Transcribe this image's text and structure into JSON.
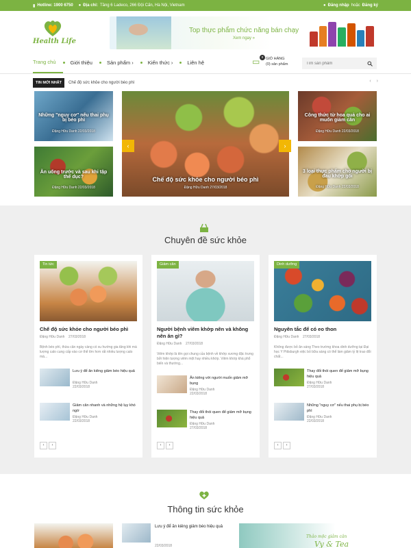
{
  "topbar": {
    "hotline": "Hotline: 1900 6750",
    "address_label": "Địa chỉ:",
    "address": "Tầng 6 Ladeco, 266 Đội Cấn, Hà Nội, Vietnam",
    "login": "Đăng nhập",
    "or": "hoặc",
    "register": "Đăng ký"
  },
  "header": {
    "logo_text": "Health Life",
    "banner_title": "Top thực phẩm chức năng bán chạy",
    "banner_link": "Xem ngay »"
  },
  "nav": {
    "items": [
      {
        "label": "Trang chủ"
      },
      {
        "label": "Giới thiệu"
      },
      {
        "label": "Sản phẩm ›"
      },
      {
        "label": "Kiến thức ›"
      },
      {
        "label": "Liên hệ"
      }
    ],
    "cart_count": "0",
    "cart_title": "GIỎ HÀNG",
    "cart_sub": "(0) sản phẩm",
    "search_placeholder": "Tìm sản phẩm"
  },
  "news": {
    "label": "TIN MỚI NHẤT",
    "text": "Chế độ sức khỏe cho người béo phì"
  },
  "slider": {
    "left_top": {
      "title": "Những \"nguy cơ\" nếu thai phụ bị béo phì",
      "meta": "Đặng Hữu Danh    22/03/2018"
    },
    "left_bottom": {
      "title": "Ăn uống trước và sau khi tập thể dục?",
      "meta": "Đặng Hữu Danh    22/03/2018"
    },
    "center": {
      "title": "Chế độ sức khỏe cho người béo phì",
      "meta": "Đặng Hữu Danh    27/03/2018"
    },
    "right_top": {
      "title": "Công thức từ hoa quả cho ai muốn giảm cân",
      "meta": "Đặng Hữu Danh    22/03/2018"
    },
    "right_bottom": {
      "title": "3 loại thực phẩm cho người bị đau khớp gối",
      "meta": "Đặng Hữu Danh    22/03/2018"
    }
  },
  "section1": {
    "title": "Chuyên đề sức khỏe"
  },
  "cards": [
    {
      "badge": "Tin tức",
      "title": "Chế độ sức khỏe cho người béo phì",
      "author": "Đặng Hữu Danh",
      "date": "27/03/2018",
      "excerpt": "Bệnh béo phì, thừa cân ngày càng có xu hướng gia tăng khi mà lượng calo cung cấp vào cơ thể lớn hơn rất nhiều lượng calo mà...",
      "items": [
        {
          "title": "Lưu ý để ăn kiêng giảm béo hiệu quả",
          "author": "Đặng Hữu Danh",
          "date": "22/03/2018"
        },
        {
          "title": "Giảm cân nhanh và những hệ lụy khó ngờ",
          "author": "Đặng Hữu Danh",
          "date": "22/03/2018"
        }
      ]
    },
    {
      "badge": "Giảm cân",
      "title": "Người bệnh viêm khớp nên và không nên ăn gì?",
      "author": "Đặng Hữu Danh",
      "date": "27/03/2018",
      "excerpt": "Viêm khớp là tên gọi chung của bệnh về khớp xương đặc trưng bởi hiện tượng viêm một hay nhiều khớp. Viêm khớp khá phổ biến và thường...",
      "items": [
        {
          "title": "Ăn kiêng với người muốn giảm mỡ bụng",
          "author": "Đặng Hữu Danh",
          "date": "22/03/2018"
        },
        {
          "title": "Thay đổi thói quen để giảm mỡ bụng hiệu quả",
          "author": "Đặng Hữu Danh",
          "date": "27/03/2018"
        }
      ]
    },
    {
      "badge": "Dinh dưỡng",
      "title": "Nguyên tắc để có eo thon",
      "author": "Đặng Hữu Danh",
      "date": "27/03/2018",
      "excerpt": "Không được bỏ ăn sáng Theo trường khoa dinh dưỡng tại Đại học Y Pittsburgh việc bỏ bữa sáng có thể làm giảm tỷ lệ trao đổi chất...",
      "items": [
        {
          "title": "Thay đổi thói quen để giảm mỡ bụng hiệu quả",
          "author": "Đặng Hữu Danh",
          "date": "27/03/2018"
        },
        {
          "title": "Những \"nguy cơ\" nếu thai phụ bị béo phì",
          "author": "Đặng Hữu Danh",
          "date": "22/03/2018"
        }
      ]
    }
  ],
  "section2": {
    "title": "Thông tin sức khỏe",
    "item_title": "Lưu ý để ăn kiêng giảm béo hiệu quả",
    "item_date": "22/03/2018",
    "ad_text1": "Thảo mộc giảm cân",
    "ad_text2": "Vy & Tea"
  },
  "colors": {
    "accent": "#7cb342",
    "slider_arrow": "#f2b705"
  }
}
